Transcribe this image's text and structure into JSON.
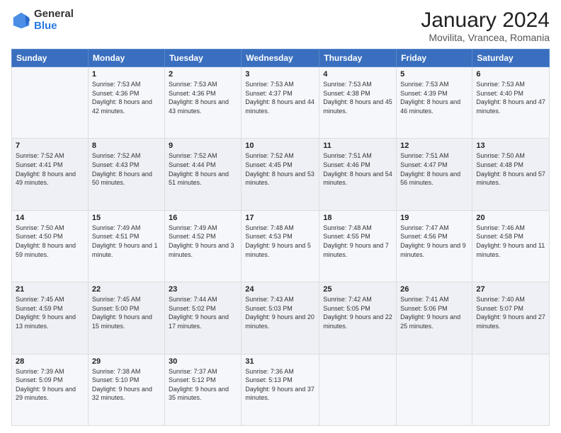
{
  "header": {
    "logo_general": "General",
    "logo_blue": "Blue",
    "main_title": "January 2024",
    "subtitle": "Movilita, Vrancea, Romania"
  },
  "columns": [
    "Sunday",
    "Monday",
    "Tuesday",
    "Wednesday",
    "Thursday",
    "Friday",
    "Saturday"
  ],
  "weeks": [
    [
      {
        "day": "",
        "sunrise": "",
        "sunset": "",
        "daylight": ""
      },
      {
        "day": "1",
        "sunrise": "Sunrise: 7:53 AM",
        "sunset": "Sunset: 4:36 PM",
        "daylight": "Daylight: 8 hours and 42 minutes."
      },
      {
        "day": "2",
        "sunrise": "Sunrise: 7:53 AM",
        "sunset": "Sunset: 4:36 PM",
        "daylight": "Daylight: 8 hours and 43 minutes."
      },
      {
        "day": "3",
        "sunrise": "Sunrise: 7:53 AM",
        "sunset": "Sunset: 4:37 PM",
        "daylight": "Daylight: 8 hours and 44 minutes."
      },
      {
        "day": "4",
        "sunrise": "Sunrise: 7:53 AM",
        "sunset": "Sunset: 4:38 PM",
        "daylight": "Daylight: 8 hours and 45 minutes."
      },
      {
        "day": "5",
        "sunrise": "Sunrise: 7:53 AM",
        "sunset": "Sunset: 4:39 PM",
        "daylight": "Daylight: 8 hours and 46 minutes."
      },
      {
        "day": "6",
        "sunrise": "Sunrise: 7:53 AM",
        "sunset": "Sunset: 4:40 PM",
        "daylight": "Daylight: 8 hours and 47 minutes."
      }
    ],
    [
      {
        "day": "7",
        "sunrise": "Sunrise: 7:52 AM",
        "sunset": "Sunset: 4:41 PM",
        "daylight": "Daylight: 8 hours and 49 minutes."
      },
      {
        "day": "8",
        "sunrise": "Sunrise: 7:52 AM",
        "sunset": "Sunset: 4:43 PM",
        "daylight": "Daylight: 8 hours and 50 minutes."
      },
      {
        "day": "9",
        "sunrise": "Sunrise: 7:52 AM",
        "sunset": "Sunset: 4:44 PM",
        "daylight": "Daylight: 8 hours and 51 minutes."
      },
      {
        "day": "10",
        "sunrise": "Sunrise: 7:52 AM",
        "sunset": "Sunset: 4:45 PM",
        "daylight": "Daylight: 8 hours and 53 minutes."
      },
      {
        "day": "11",
        "sunrise": "Sunrise: 7:51 AM",
        "sunset": "Sunset: 4:46 PM",
        "daylight": "Daylight: 8 hours and 54 minutes."
      },
      {
        "day": "12",
        "sunrise": "Sunrise: 7:51 AM",
        "sunset": "Sunset: 4:47 PM",
        "daylight": "Daylight: 8 hours and 56 minutes."
      },
      {
        "day": "13",
        "sunrise": "Sunrise: 7:50 AM",
        "sunset": "Sunset: 4:48 PM",
        "daylight": "Daylight: 8 hours and 57 minutes."
      }
    ],
    [
      {
        "day": "14",
        "sunrise": "Sunrise: 7:50 AM",
        "sunset": "Sunset: 4:50 PM",
        "daylight": "Daylight: 8 hours and 59 minutes."
      },
      {
        "day": "15",
        "sunrise": "Sunrise: 7:49 AM",
        "sunset": "Sunset: 4:51 PM",
        "daylight": "Daylight: 9 hours and 1 minute."
      },
      {
        "day": "16",
        "sunrise": "Sunrise: 7:49 AM",
        "sunset": "Sunset: 4:52 PM",
        "daylight": "Daylight: 9 hours and 3 minutes."
      },
      {
        "day": "17",
        "sunrise": "Sunrise: 7:48 AM",
        "sunset": "Sunset: 4:53 PM",
        "daylight": "Daylight: 9 hours and 5 minutes."
      },
      {
        "day": "18",
        "sunrise": "Sunrise: 7:48 AM",
        "sunset": "Sunset: 4:55 PM",
        "daylight": "Daylight: 9 hours and 7 minutes."
      },
      {
        "day": "19",
        "sunrise": "Sunrise: 7:47 AM",
        "sunset": "Sunset: 4:56 PM",
        "daylight": "Daylight: 9 hours and 9 minutes."
      },
      {
        "day": "20",
        "sunrise": "Sunrise: 7:46 AM",
        "sunset": "Sunset: 4:58 PM",
        "daylight": "Daylight: 9 hours and 11 minutes."
      }
    ],
    [
      {
        "day": "21",
        "sunrise": "Sunrise: 7:45 AM",
        "sunset": "Sunset: 4:59 PM",
        "daylight": "Daylight: 9 hours and 13 minutes."
      },
      {
        "day": "22",
        "sunrise": "Sunrise: 7:45 AM",
        "sunset": "Sunset: 5:00 PM",
        "daylight": "Daylight: 9 hours and 15 minutes."
      },
      {
        "day": "23",
        "sunrise": "Sunrise: 7:44 AM",
        "sunset": "Sunset: 5:02 PM",
        "daylight": "Daylight: 9 hours and 17 minutes."
      },
      {
        "day": "24",
        "sunrise": "Sunrise: 7:43 AM",
        "sunset": "Sunset: 5:03 PM",
        "daylight": "Daylight: 9 hours and 20 minutes."
      },
      {
        "day": "25",
        "sunrise": "Sunrise: 7:42 AM",
        "sunset": "Sunset: 5:05 PM",
        "daylight": "Daylight: 9 hours and 22 minutes."
      },
      {
        "day": "26",
        "sunrise": "Sunrise: 7:41 AM",
        "sunset": "Sunset: 5:06 PM",
        "daylight": "Daylight: 9 hours and 25 minutes."
      },
      {
        "day": "27",
        "sunrise": "Sunrise: 7:40 AM",
        "sunset": "Sunset: 5:07 PM",
        "daylight": "Daylight: 9 hours and 27 minutes."
      }
    ],
    [
      {
        "day": "28",
        "sunrise": "Sunrise: 7:39 AM",
        "sunset": "Sunset: 5:09 PM",
        "daylight": "Daylight: 9 hours and 29 minutes."
      },
      {
        "day": "29",
        "sunrise": "Sunrise: 7:38 AM",
        "sunset": "Sunset: 5:10 PM",
        "daylight": "Daylight: 9 hours and 32 minutes."
      },
      {
        "day": "30",
        "sunrise": "Sunrise: 7:37 AM",
        "sunset": "Sunset: 5:12 PM",
        "daylight": "Daylight: 9 hours and 35 minutes."
      },
      {
        "day": "31",
        "sunrise": "Sunrise: 7:36 AM",
        "sunset": "Sunset: 5:13 PM",
        "daylight": "Daylight: 9 hours and 37 minutes."
      },
      {
        "day": "",
        "sunrise": "",
        "sunset": "",
        "daylight": ""
      },
      {
        "day": "",
        "sunrise": "",
        "sunset": "",
        "daylight": ""
      },
      {
        "day": "",
        "sunrise": "",
        "sunset": "",
        "daylight": ""
      }
    ]
  ]
}
